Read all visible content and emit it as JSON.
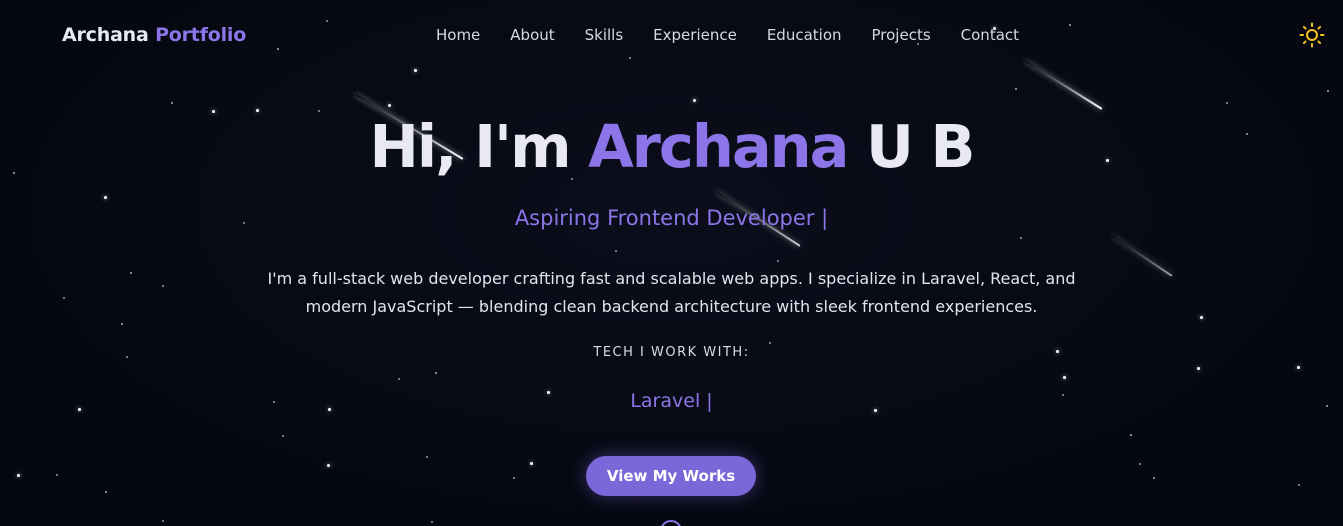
{
  "header": {
    "logo_first": "Archana",
    "logo_second": "Portfolio",
    "nav": [
      "Home",
      "About",
      "Skills",
      "Experience",
      "Education",
      "Projects",
      "Contact"
    ],
    "theme_icon": "sun-icon"
  },
  "hero": {
    "greeting": "Hi, I'm",
    "name_accent": "Archana",
    "name_rest": "U B",
    "subtitle": "Aspiring Frontend Developer |",
    "intro": "I'm a full-stack web developer crafting fast and scalable web apps. I specialize in Laravel, React, and modern JavaScript — blending clean backend architecture with sleek frontend experiences.",
    "tech_label": "TECH I WORK WITH:",
    "tech_value": "Laravel |",
    "cta_label": "View My Works"
  },
  "colors": {
    "background": "#060811",
    "accent": "#8c75e8",
    "button": "#7b67d8",
    "sun": "#f4c21b"
  }
}
